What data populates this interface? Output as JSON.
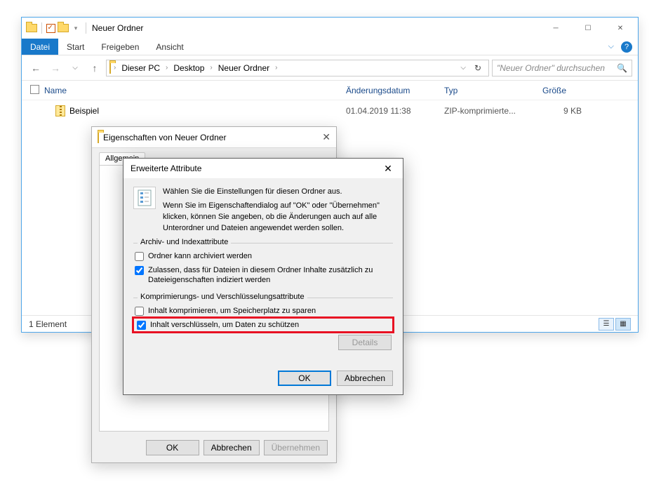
{
  "explorer": {
    "title": "Neuer Ordner",
    "tabs": {
      "file": "Datei",
      "start": "Start",
      "share": "Freigeben",
      "view": "Ansicht"
    },
    "breadcrumb": [
      "Dieser PC",
      "Desktop",
      "Neuer Ordner"
    ],
    "search_placeholder": "\"Neuer Ordner\" durchsuchen",
    "columns": {
      "name": "Name",
      "date": "Änderungsdatum",
      "type": "Typ",
      "size": "Größe"
    },
    "rows": [
      {
        "name": "Beispiel",
        "date": "01.04.2019 11:38",
        "type": "ZIP-komprimierte...",
        "size": "9 KB"
      }
    ],
    "status": "1 Element"
  },
  "properties": {
    "title": "Eigenschaften von Neuer Ordner",
    "tab": "Allgemein",
    "ok": "OK",
    "cancel": "Abbrechen",
    "apply": "Übernehmen"
  },
  "advanced": {
    "title": "Erweiterte Attribute",
    "intro1": "Wählen Sie die Einstellungen für diesen Ordner aus.",
    "intro2": "Wenn Sie im Eigenschaftendialog auf \"OK\" oder \"Übernehmen\" klicken, können Sie angeben, ob die Änderungen auch auf alle Unterordner und Dateien angewendet werden sollen.",
    "group1": "Archiv- und Indexattribute",
    "check_archive": "Ordner kann archiviert werden",
    "check_index": "Zulassen, dass für Dateien in diesem Ordner Inhalte zusätzlich zu Dateieigenschaften indiziert werden",
    "group2": "Komprimierungs- und Verschlüsselungsattribute",
    "check_compress": "Inhalt komprimieren, um Speicherplatz zu sparen",
    "check_encrypt": "Inhalt verschlüsseln, um Daten zu schützen",
    "details": "Details",
    "ok": "OK",
    "cancel": "Abbrechen",
    "values": {
      "archive": false,
      "index": true,
      "compress": false,
      "encrypt": true
    }
  }
}
